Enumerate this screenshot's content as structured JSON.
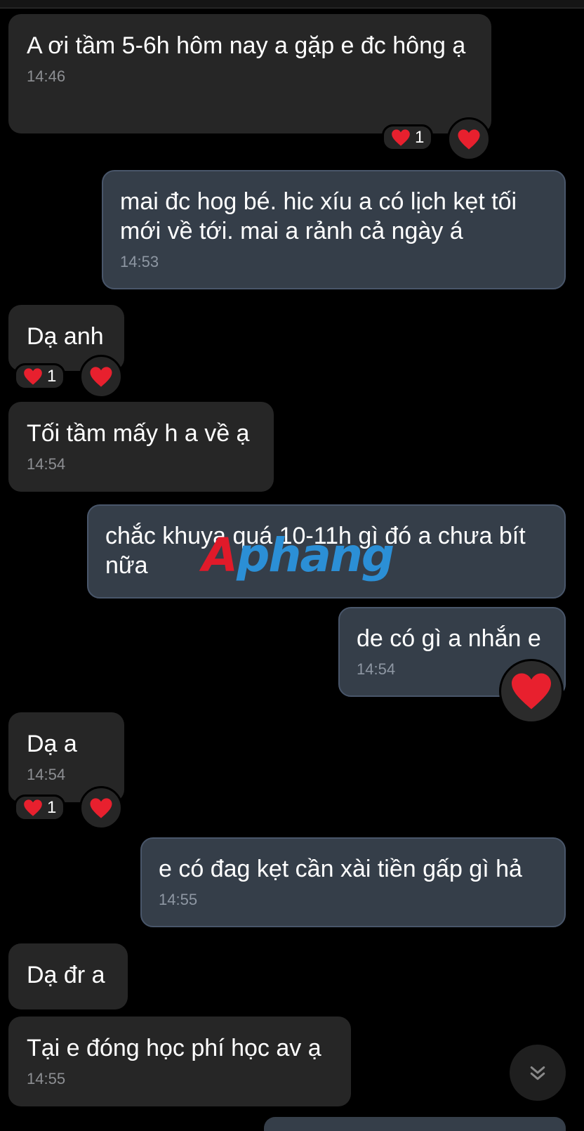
{
  "messages": [
    {
      "text": "A ơi tầm 5-6h hôm nay a gặp e đc hông ạ",
      "time": "14:46"
    },
    {
      "text": "mai đc hog bé. hic xíu a có lịch kẹt tối mới về tới. mai a rảnh cả ngày á",
      "time": "14:53"
    },
    {
      "text": "Dạ anh"
    },
    {
      "text": "Tối tầm mấy h a về ạ",
      "time": "14:54"
    },
    {
      "text": "chắc khuya quá 10-11h gì đó a chưa bít nữa"
    },
    {
      "text": "de có gì a nhắn e",
      "time": "14:54"
    },
    {
      "text": "Dạ a",
      "time": "14:54"
    },
    {
      "text": "e có đag kẹt cần xài tiền gấp gì hả",
      "time": "14:55"
    },
    {
      "text": "Dạ đr a"
    },
    {
      "text": "Tại e đóng học phí học av ạ",
      "time": "14:55"
    }
  ],
  "reactions": [
    {
      "emoji": "heart-icon",
      "count": "1"
    },
    {
      "emoji": "heart-icon",
      "count": "1"
    },
    {
      "emoji": "heart-icon",
      "count": "1"
    }
  ],
  "watermark": {
    "part1": "A",
    "part2": "phang"
  },
  "colors": {
    "background": "#000000",
    "incoming_bubble": "#262626",
    "outgoing_bubble": "#353e49",
    "outgoing_border": "#49566a",
    "heart": "#e8202e",
    "timestamp": "#8d8f93"
  }
}
